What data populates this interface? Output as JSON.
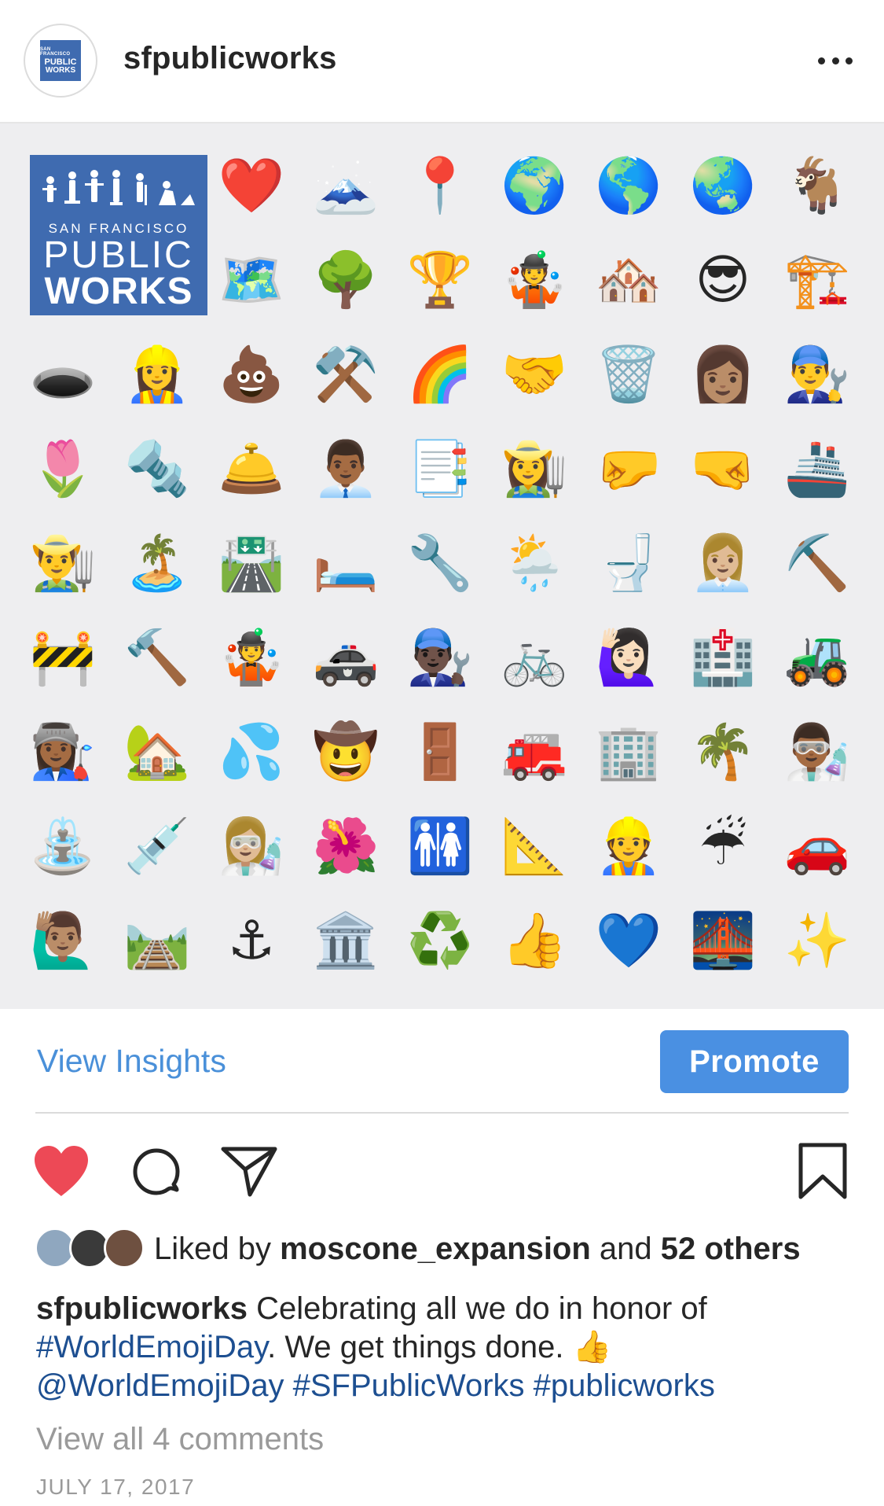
{
  "post": {
    "username": "sfpublicworks",
    "avatar_logo": {
      "line1": "SAN FRANCISCO",
      "line2": "PUBLIC",
      "line3": "WORKS"
    },
    "more_icon": "more-horizontal-icon"
  },
  "image": {
    "logo": {
      "line1": "SAN FRANCISCO",
      "line2": "PUBLIC",
      "line3": "WORKS",
      "color": "#3f6bb0"
    },
    "emoji_rows": [
      [
        "❤️",
        "🗻",
        "📍",
        "🌍",
        "🌎",
        "🌏",
        "🐐"
      ],
      [
        "🗺️",
        "🌳",
        "🏆",
        "🤹",
        "🏘️",
        "😎",
        "🏗️"
      ],
      [
        "🕳️",
        "👷‍♀️",
        "💩",
        "⚒️",
        "🌈",
        "🤝",
        "🗑️",
        "👩🏽",
        "👨‍🔧"
      ],
      [
        "🌷",
        "🔩",
        "🛎️",
        "👨🏾‍💼",
        "📑",
        "👩‍🌾",
        "🤛",
        "🤜",
        "🚢"
      ],
      [
        "👨‍🌾",
        "🏝️",
        "🛣️",
        "🛏️",
        "🔧",
        "🌦️",
        "🚽",
        "👩🏼‍💼",
        "⛏️"
      ],
      [
        "🚧",
        "🔨",
        "🤹",
        "🚓",
        "👨🏿‍🔧",
        "🚲",
        "🙋🏻‍♀️",
        "🏥",
        "🚜"
      ],
      [
        "👩🏾‍🏭",
        "🏡",
        "💦",
        "🤠",
        "🚪",
        "🚒",
        "🏢",
        "🌴",
        "👨🏾‍🔬"
      ],
      [
        "⛲",
        "💉",
        "👩🏼‍🔬",
        "🌺",
        "🚻",
        "📐",
        "👷",
        "☔",
        "🚗"
      ],
      [
        "🙋🏽‍♂️",
        "🛤️",
        "⚓",
        "🏛️",
        "♻️",
        "👍",
        "💙",
        "🌉",
        "✨"
      ]
    ]
  },
  "actions": {
    "insights_label": "View Insights",
    "promote_label": "Promote",
    "like_icon": "heart-icon",
    "comment_icon": "comment-icon",
    "share_icon": "paper-plane-icon",
    "save_icon": "bookmark-icon",
    "like_color": "#ed4956",
    "accent_color": "#4a90e2"
  },
  "likes": {
    "prefix": "Liked by ",
    "first_user": "moscone_expansion",
    "middle": " and ",
    "others": "52 others"
  },
  "caption": {
    "username": "sfpublicworks",
    "text1": " Celebrating all we do in honor of ",
    "hashtag1": "#WorldEmojiDay",
    "text2": ". We get things done. ",
    "emoji": "👍",
    "mention": "@WorldEmojiDay",
    "hashtag2": "#SFPublicWorks",
    "hashtag3": "#publicworks"
  },
  "comments_link": "View all 4 comments",
  "date": "JULY 17, 2017"
}
